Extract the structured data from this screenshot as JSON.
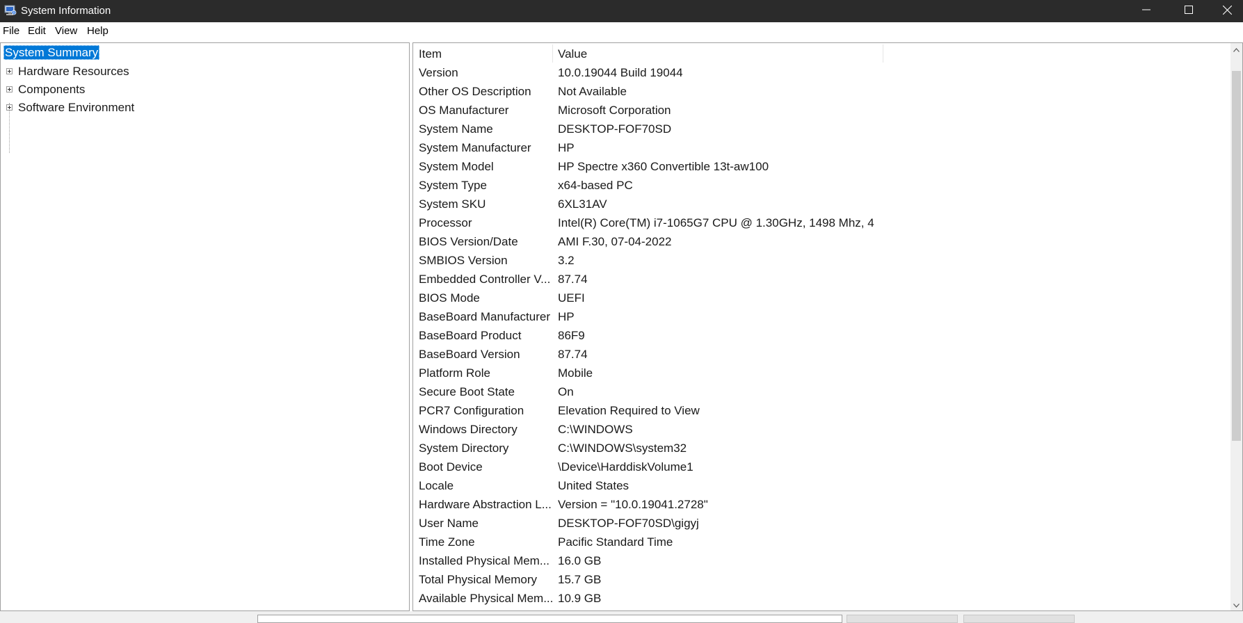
{
  "window": {
    "title": "System Information"
  },
  "menu": {
    "file": "File",
    "edit": "Edit",
    "view": "View",
    "help": "Help"
  },
  "tree": {
    "root": "System Summary",
    "children": [
      {
        "label": "Hardware Resources"
      },
      {
        "label": "Components"
      },
      {
        "label": "Software Environment"
      }
    ]
  },
  "table": {
    "headers": {
      "item": "Item",
      "value": "Value"
    },
    "rows": [
      {
        "item": "Version",
        "value": "10.0.19044 Build 19044"
      },
      {
        "item": "Other OS Description",
        "value": "Not Available"
      },
      {
        "item": "OS Manufacturer",
        "value": "Microsoft Corporation"
      },
      {
        "item": "System Name",
        "value": "DESKTOP-FOF70SD"
      },
      {
        "item": "System Manufacturer",
        "value": "HP"
      },
      {
        "item": "System Model",
        "value": "HP Spectre x360 Convertible 13t-aw100"
      },
      {
        "item": "System Type",
        "value": "x64-based PC"
      },
      {
        "item": "System SKU",
        "value": "6XL31AV"
      },
      {
        "item": "Processor",
        "value": "Intel(R) Core(TM) i7-1065G7 CPU @ 1.30GHz, 1498 Mhz, 4 ..."
      },
      {
        "item": "BIOS Version/Date",
        "value": "AMI F.30, 07-04-2022"
      },
      {
        "item": "SMBIOS Version",
        "value": "3.2"
      },
      {
        "item": "Embedded Controller V...",
        "value": "87.74"
      },
      {
        "item": "BIOS Mode",
        "value": "UEFI"
      },
      {
        "item": "BaseBoard Manufacturer",
        "value": "HP"
      },
      {
        "item": "BaseBoard Product",
        "value": "86F9"
      },
      {
        "item": "BaseBoard Version",
        "value": "87.74"
      },
      {
        "item": "Platform Role",
        "value": "Mobile"
      },
      {
        "item": "Secure Boot State",
        "value": "On"
      },
      {
        "item": "PCR7 Configuration",
        "value": "Elevation Required to View"
      },
      {
        "item": "Windows Directory",
        "value": "C:\\WINDOWS"
      },
      {
        "item": "System Directory",
        "value": "C:\\WINDOWS\\system32"
      },
      {
        "item": "Boot Device",
        "value": "\\Device\\HarddiskVolume1"
      },
      {
        "item": "Locale",
        "value": "United States"
      },
      {
        "item": "Hardware Abstraction L...",
        "value": "Version = \"10.0.19041.2728\""
      },
      {
        "item": "User Name",
        "value": "DESKTOP-FOF70SD\\gigyj"
      },
      {
        "item": "Time Zone",
        "value": "Pacific Standard Time"
      },
      {
        "item": "Installed Physical Mem...",
        "value": "16.0 GB"
      },
      {
        "item": "Total Physical Memory",
        "value": "15.7 GB"
      },
      {
        "item": "Available Physical Mem...",
        "value": "10.9 GB"
      }
    ]
  },
  "colors": {
    "titlebar": "#2b2b2b",
    "selection": "#0078d7",
    "scroll_thumb": "#cdcdcd"
  },
  "icons": {
    "app": "system-information-icon",
    "minimize": "minimize-icon",
    "maximize": "maximize-icon",
    "close": "close-icon",
    "scroll_up": "arrow-up-icon",
    "scroll_down": "arrow-down-icon"
  }
}
